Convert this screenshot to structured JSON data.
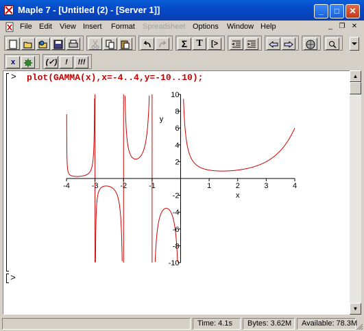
{
  "window": {
    "title": "Maple 7  - [Untitled (2) - [Server 1]]",
    "controls": {
      "minimize": "_",
      "maximize": "□",
      "close": "✕"
    }
  },
  "menubar": {
    "items": [
      "File",
      "Edit",
      "View",
      "Insert",
      "Format",
      "Spreadsheet",
      "Options",
      "Window",
      "Help"
    ],
    "disabled": [
      "Spreadsheet"
    ],
    "mdi_controls": {
      "minimize": "_",
      "restore": "❐",
      "close": "✕"
    }
  },
  "toolbar": {
    "math_label": "Σ",
    "text_label": "T",
    "prompt_label": "[>",
    "zoom_label": "🔍"
  },
  "context_bar": {
    "x_label": "x",
    "eval_label": "(✓)",
    "bang_label": "!",
    "triple_bang_label": "!!!"
  },
  "worksheet": {
    "prompt_symbol": ">",
    "command": "plot(GAMMA(x),x=-4..4,y=-10..10);",
    "empty_prompt": ">"
  },
  "chart_data": {
    "type": "line",
    "function": "GAMMA(x)",
    "xlabel": "x",
    "ylabel": "y",
    "xlim": [
      -4,
      4
    ],
    "ylim": [
      -10,
      10
    ],
    "x_ticks": [
      -4,
      -3,
      -2,
      -1,
      1,
      2,
      3,
      4
    ],
    "y_ticks": [
      10,
      8,
      6,
      4,
      2,
      -2,
      -4,
      -6,
      -8,
      -10
    ],
    "asymptotes_x": [
      -3,
      -2,
      -1,
      0
    ],
    "line_color": "#cc0000",
    "grid": false
  },
  "statusbar": {
    "time": "Time:  4.1s",
    "bytes": "Bytes: 3.62M",
    "available": "Available: 78.3M"
  }
}
